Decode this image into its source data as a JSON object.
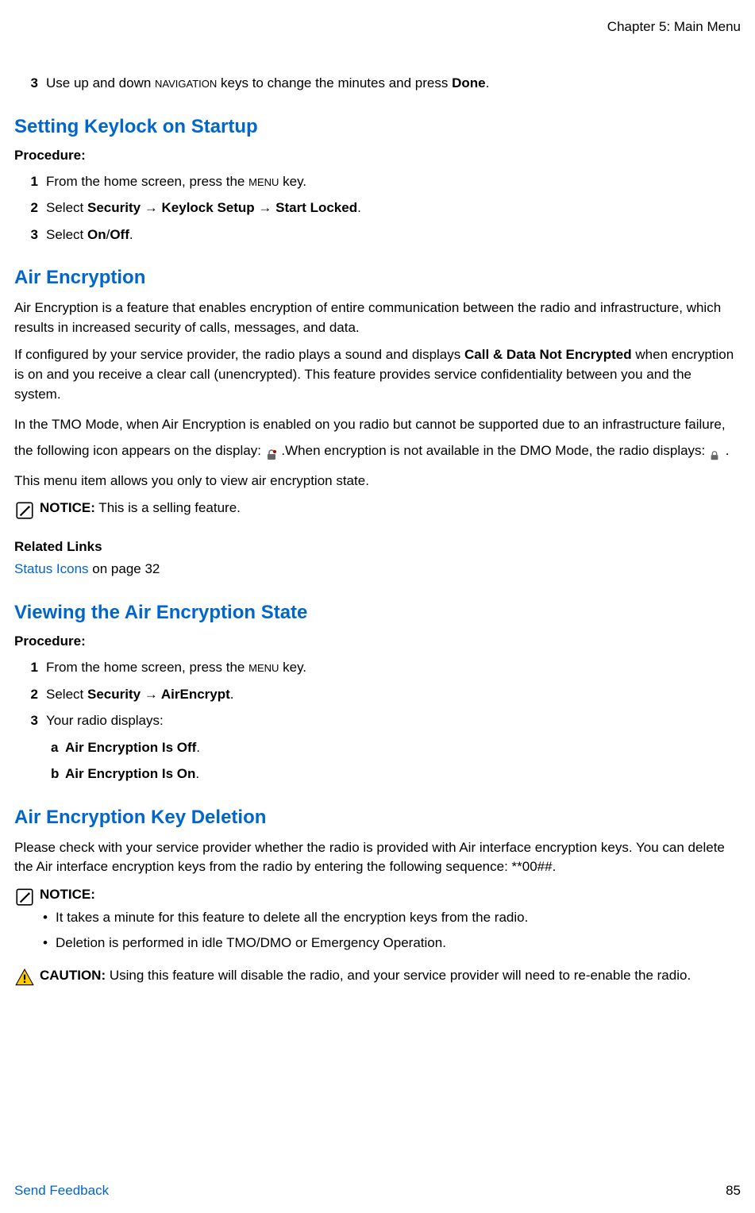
{
  "header": {
    "chapter": "Chapter 5: Main Menu"
  },
  "orphan_step": {
    "num": "3",
    "prefix": "Use up and down ",
    "sc1": "NAVIGATION",
    "middle": " keys to change the minutes and press ",
    "bold1": "Done",
    "suffix": "."
  },
  "section_keylock": {
    "title": "Setting Keylock on Startup",
    "procedure_label": "Procedure:",
    "steps": {
      "s1": {
        "num": "1",
        "prefix": "From the home screen, press the ",
        "sc": "MENU",
        "suffix": " key."
      },
      "s2": {
        "num": "2",
        "prefix": "Select ",
        "bold": "Security → Keylock Setup → Start Locked",
        "suffix": "."
      },
      "s3": {
        "num": "3",
        "prefix": "Select ",
        "bold1": "On",
        "sep": "/",
        "bold2": "Off",
        "suffix": "."
      }
    }
  },
  "section_air": {
    "title": "Air Encryption",
    "para1": "Air Encryption is a feature that enables encryption of entire communication between the radio and infrastructure, which results in increased security of calls, messages, and data.",
    "para2_prefix": "If configured by your service provider, the radio plays a sound and displays ",
    "para2_bold": "Call & Data Not Encrypted",
    "para2_suffix": " when encryption is on and you receive a clear call (unencrypted). This feature provides service confidentiality between you and the system.",
    "para3_prefix": "In the TMO Mode, when Air Encryption is enabled on you radio but cannot be supported due to an infrastructure failure, the following icon appears on the display: ",
    "para3_middle": ".When encryption is not available in the DMO Mode, the radio displays: ",
    "para3_suffix": ".",
    "para4": "This menu item allows you only to view air encryption state.",
    "notice_label": "NOTICE:",
    "notice_text": " This is a selling feature.",
    "related_label": "Related Links",
    "related_link": "Status Icons",
    "related_suffix": " on page 32"
  },
  "section_view": {
    "title": "Viewing the Air Encryption State",
    "procedure_label": "Procedure:",
    "steps": {
      "s1": {
        "num": "1",
        "prefix": "From the home screen, press the ",
        "sc": "MENU",
        "suffix": " key."
      },
      "s2": {
        "num": "2",
        "prefix": "Select ",
        "bold": "Security → AirEncrypt",
        "suffix": "."
      },
      "s3": {
        "num": "3",
        "text": "Your radio displays:"
      }
    },
    "sub": {
      "a": {
        "num": "a",
        "bold": "Air Encryption Is Off",
        "suffix": "."
      },
      "b": {
        "num": "b",
        "bold": "Air Encryption Is On",
        "suffix": "."
      }
    }
  },
  "section_delete": {
    "title": "Air Encryption Key Deletion",
    "para1": "Please check with your service provider whether the radio is provided with Air interface encryption keys. You can delete the Air interface encryption keys from the radio by entering the following sequence: **00##.",
    "notice_label": "NOTICE:",
    "notice_bullet1": "It takes a minute for this feature to delete all the encryption keys from the radio.",
    "notice_bullet2": "Deletion is performed in idle TMO/DMO or Emergency Operation.",
    "caution_label": "CAUTION:",
    "caution_text": " Using this feature will disable the radio, and your service provider will need to re-enable the radio."
  },
  "footer": {
    "feedback": "Send Feedback",
    "page": "85"
  }
}
